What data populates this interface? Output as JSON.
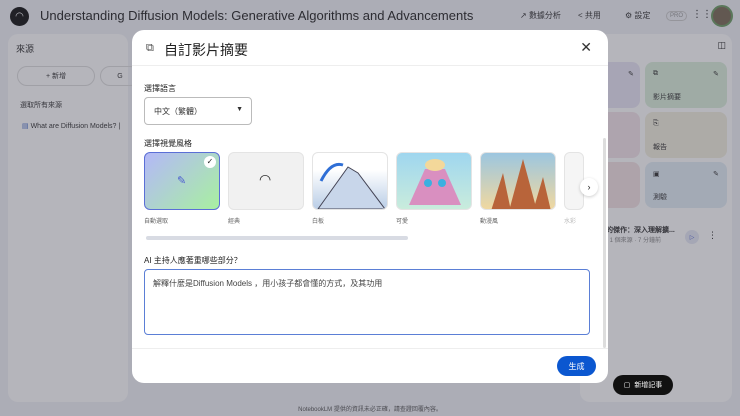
{
  "header": {
    "title": "Understanding Diffusion Models: Generative Algorithms and Advancements",
    "analytics": "數據分析",
    "share": "共用",
    "settings": "設定",
    "pro": "PRO"
  },
  "sources": {
    "title": "來源",
    "add": "新增",
    "select_all": "選取所有來源",
    "item": "What are Diffusion Models? |"
  },
  "studio": {
    "video_card": "影片摘要",
    "report_card": "報告",
    "quiz_card": "測驗",
    "item_title": "的傑作：深入理解擴...",
    "item_meta": "· 1 個來源 · 7 分鐘前",
    "add_note": "新增記事"
  },
  "modal": {
    "title": "自訂影片摘要",
    "language_label": "選擇語言",
    "language_value": "中文（繁體）",
    "style_label": "選擇視覺風格",
    "styles": [
      {
        "label": "自動選取"
      },
      {
        "label": "經典"
      },
      {
        "label": "白板"
      },
      {
        "label": "可愛"
      },
      {
        "label": "動漫風"
      },
      {
        "label": "水彩"
      }
    ],
    "focus_label": "AI 主持人應著重哪些部分？",
    "focus_value": "解釋什麼是Diffusion Models ，用小孩子都會懂的方式，及其功用",
    "generate": "生成"
  },
  "footer": "NotebookLM 提供的資訊未必正確，請查證回覆內容。"
}
